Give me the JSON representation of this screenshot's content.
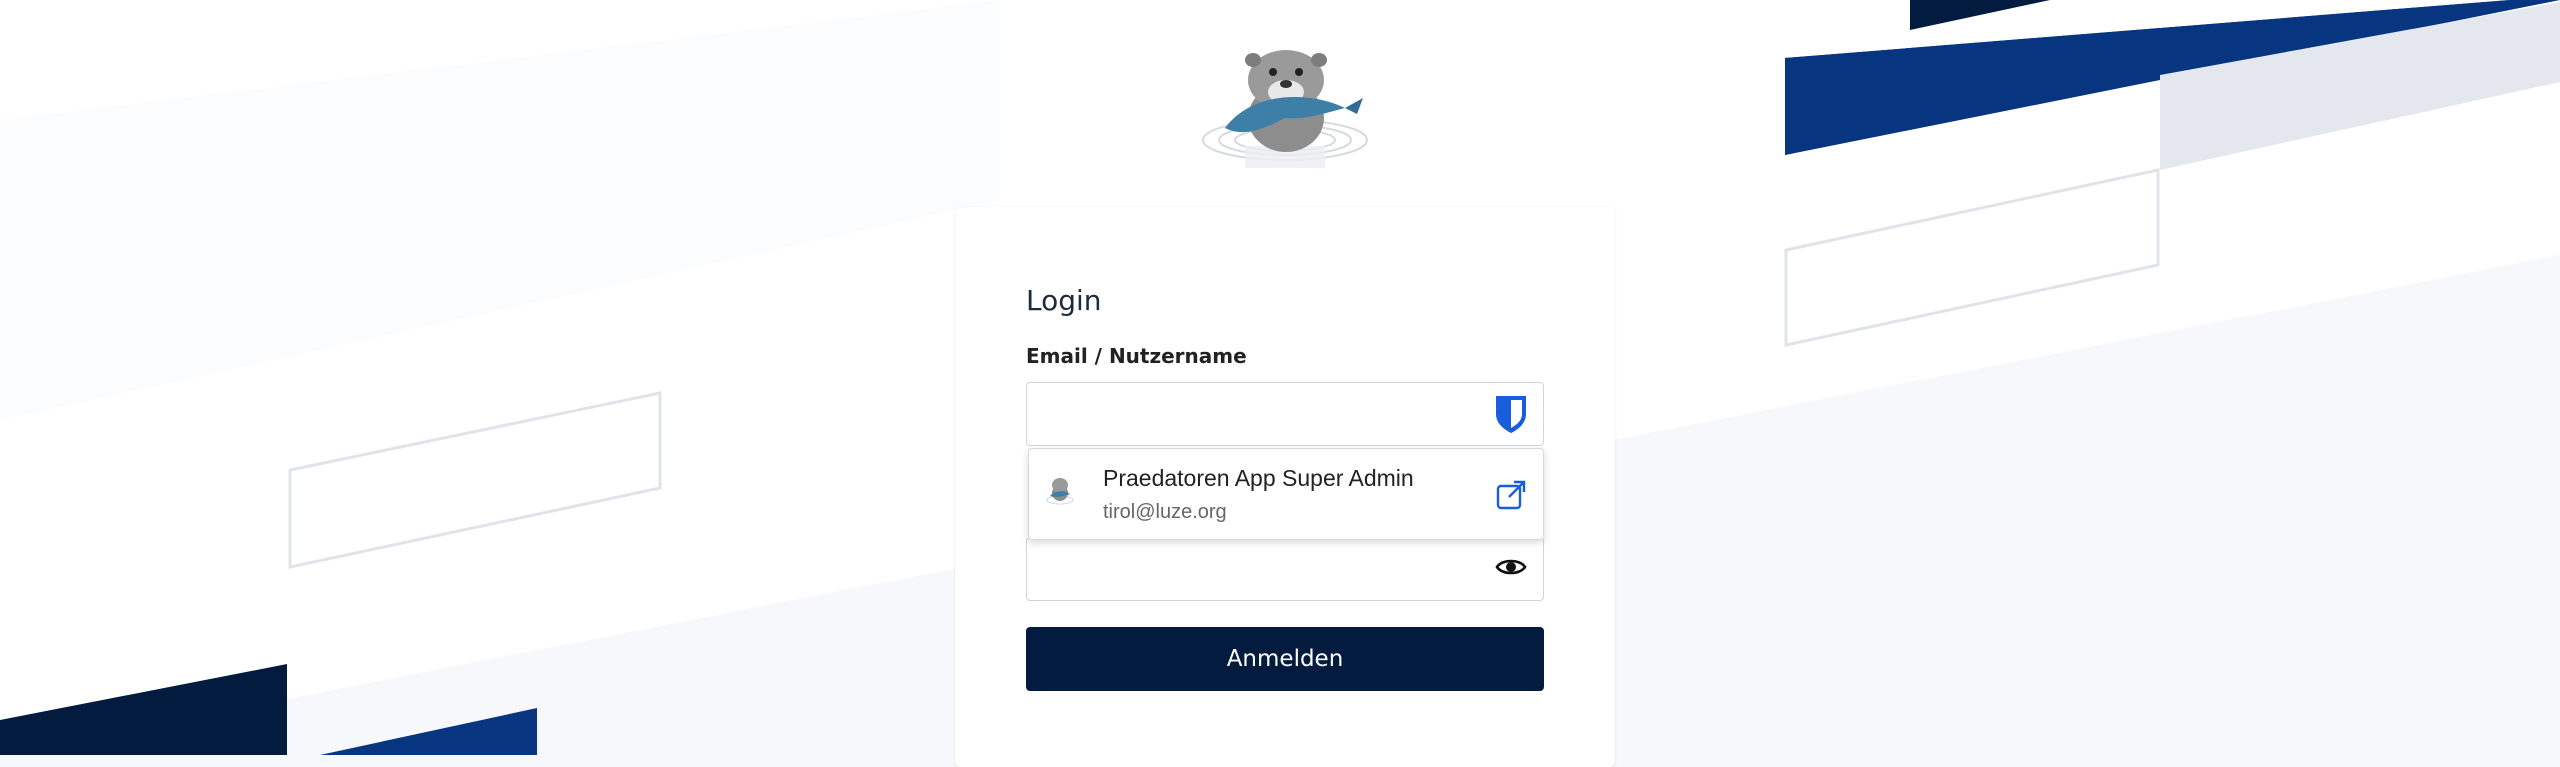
{
  "login": {
    "title": "Login",
    "email_label": "Email / Nutzername",
    "email_value": "",
    "password_value": "",
    "submit_label": "Anmelden"
  },
  "autofill": {
    "name": "Praedatoren App Super Admin",
    "email": "tirol@luze.org"
  },
  "icons": {
    "logo": "otter-logo",
    "password_manager": "bitwarden-shield-icon",
    "show_password": "eye-icon",
    "open_external": "open-external-icon"
  },
  "colors": {
    "primary_dark": "#031b3e",
    "brand_blue": "#073580",
    "bitwarden_blue": "#175ddc"
  }
}
